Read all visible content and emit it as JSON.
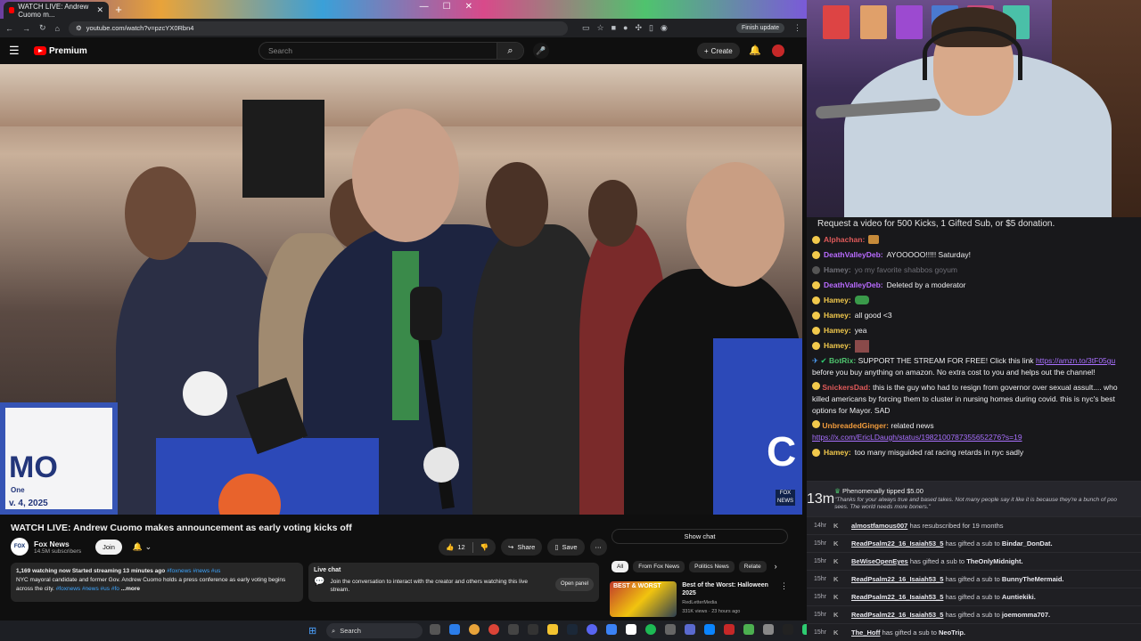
{
  "browser": {
    "tab_title": "WATCH LIVE: Andrew Cuomo m...",
    "url": "youtube.com/watch?v=pzcYX0Rbn4",
    "finish_update": "Finish update"
  },
  "youtube": {
    "brand": "Premium",
    "search_placeholder": "Search",
    "create_label": "Create"
  },
  "video": {
    "title": "WATCH LIVE: Andrew Cuomo makes announcement as early voting kicks off",
    "sign_text": "MO",
    "sign_date": "v. 4, 2025",
    "sign_small": "One",
    "sign_right": "C",
    "channel_name": "Fox News",
    "subscribers": "14.5M subscribers",
    "join_label": "Join",
    "like_count": "12",
    "share_label": "Share",
    "save_label": "Save",
    "description_stats": "1,169 watching now  Started streaming 13 minutes ago",
    "description_tags_1": "#foxnews #news #us",
    "description_text": "NYC mayoral candidate and former Gov. Andrew Cuomo holds a press conference as early voting begins across the city.",
    "description_tags_2": "#foxnews #news #us #fo",
    "more_label": "...more",
    "livechat_title": "Live chat",
    "livechat_text": "Join the conversation to interact with the creator and others watching this live stream.",
    "open_panel": "Open panel",
    "show_chat": "Show chat",
    "chips": [
      "All",
      "From Fox News",
      "Politics News",
      "Relate"
    ],
    "reco": {
      "thumb_text": "BEST & WORST",
      "title": "Best of the Worst: Halloween 2025",
      "channel": "RedLetterMedia",
      "meta": "331K views · 23 hours ago"
    }
  },
  "taskbar": {
    "search": "Search"
  },
  "chat": {
    "banner": "Request a video for 500 Kicks, 1 Gifted Sub, or $5 donation.",
    "messages": [
      {
        "user": "Alphachan:",
        "text": "",
        "color": "#e05a5a"
      },
      {
        "user": "DeathValleyDeb:",
        "text": "AYOOOOO!!!!! Saturday!",
        "color": "#b96bff"
      },
      {
        "user": "Hamey:",
        "text": "yo my favorite shabbos goyum",
        "color": "#6f6f77",
        "deleted": true
      },
      {
        "user": "DeathValleyDeb:",
        "text": "Deleted by a moderator",
        "color": "#b96bff"
      },
      {
        "user": "Hamey:",
        "text": "",
        "color": "#f2c94c"
      },
      {
        "user": "Hamey:",
        "text": "all good <3",
        "color": "#f2c94c"
      },
      {
        "user": "Hamey:",
        "text": "yea",
        "color": "#f2c94c"
      },
      {
        "user": "Hamey:",
        "text": "",
        "color": "#f2c94c"
      }
    ],
    "botrix_user": "BotRix:",
    "botrix_text": "SUPPORT THE STREAM FOR FREE! Click this link",
    "botrix_link": "https://amzn.to/3tF05gu",
    "botrix_text2": "before you buy anything on amazon. No extra cost to you and helps out the channel!",
    "snickers_user": "SnickersDad:",
    "snickers_text": "this is the guy who had to resign from governor over sexual assult.... who killed americans by forcing them to cluster in nursing homes during covid. this is nyc's best options for Mayor. SAD",
    "ginger_user": "UnbreadedGinger:",
    "ginger_text": "related news",
    "ginger_link": "https://x.com/EricLDaugh/status/1982100787355652276?s=19",
    "last_user": "Hamey:",
    "last_text": "too many misguided rat racing retards in nyc sadly"
  },
  "events": {
    "tip": {
      "time": "13m",
      "user": "Phenomenally",
      "action": "tipped",
      "amount": "$5.00",
      "quote": "\"Thanks for your always true and based takes. Not many people say it like it is because they're a bunch of poo sees. The world needs more boners.\""
    },
    "rows": [
      {
        "time": "14hr",
        "who": "almostfamous007",
        "text": "has resubscribed for 19 months",
        "target": ""
      },
      {
        "time": "15hr",
        "who": "ReadPsalm22_16_Isaiah53_5",
        "text": "has gifted a sub to",
        "target": "Bindar_DonDat."
      },
      {
        "time": "15hr",
        "who": "BeWiseOpenEyes",
        "text": "has gifted a sub to",
        "target": "TheOnlyMidnight."
      },
      {
        "time": "15hr",
        "who": "ReadPsalm22_16_Isaiah53_5",
        "text": "has gifted a sub to",
        "target": "BunnyTheMermaid."
      },
      {
        "time": "15hr",
        "who": "ReadPsalm22_16_Isaiah53_5",
        "text": "has gifted a sub to",
        "target": "Auntiekiki."
      },
      {
        "time": "15hr",
        "who": "ReadPsalm22_16_Isaiah53_5",
        "text": "has gifted a sub to",
        "target": "joemomma707."
      },
      {
        "time": "15hr",
        "who": "The_Hoff",
        "text": "has gifted a sub to",
        "target": "NeoTrip."
      }
    ]
  }
}
